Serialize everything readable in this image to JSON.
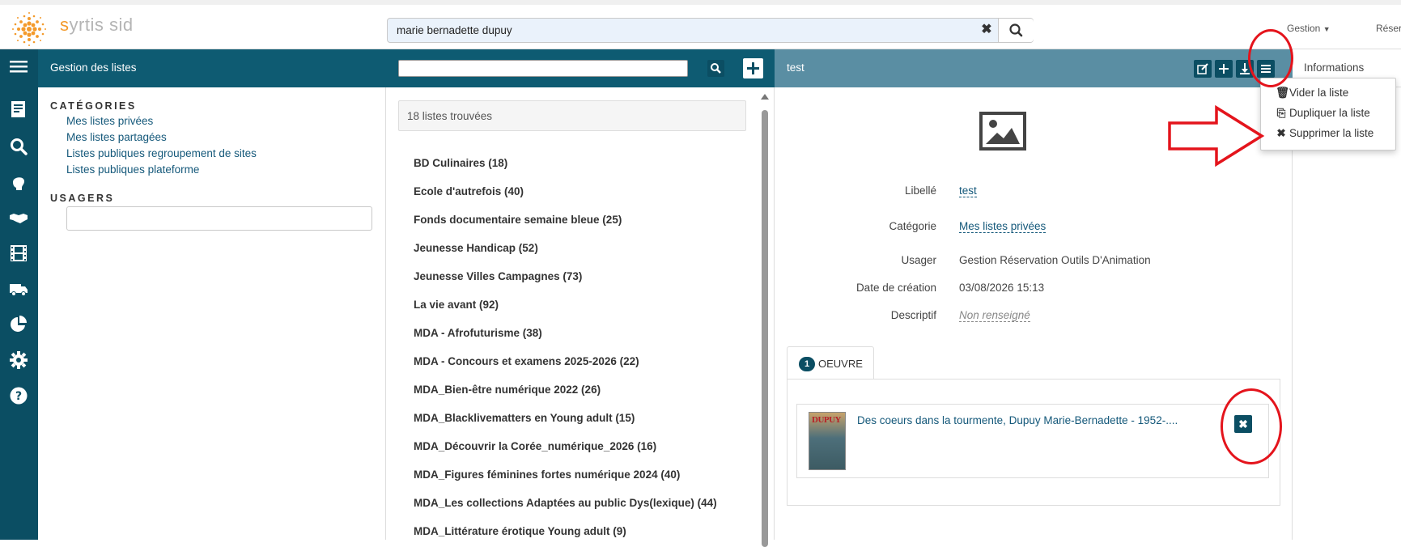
{
  "app": {
    "brand_prefix": "s",
    "brand_rest": "yrtis sid"
  },
  "search": {
    "value": "marie bernadette dupuy",
    "clear_icon": "times-icon",
    "search_icon": "search-icon"
  },
  "topmenu": {
    "gestion": "Gestion",
    "reser": "Réser"
  },
  "rail_icons": [
    "menu-icon",
    "catalog-icon",
    "search-icon",
    "user-head-icon",
    "handshake-icon",
    "film-icon",
    "truck-icon",
    "pie-chart-icon",
    "gear-icon",
    "help-icon"
  ],
  "left_panel": {
    "header": "Gestion des listes",
    "categories_title": "CATÉGORIES",
    "categories": [
      "Mes listes privées",
      "Mes listes partagées",
      "Listes publiques regroupement de sites",
      "Listes publiques plateforme"
    ],
    "usagers_title": "USAGERS",
    "usagers_value": ""
  },
  "mid_panel": {
    "count": "18 listes trouvées",
    "search_value": "",
    "lists": [
      "BD Culinaires (18)",
      "Ecole d'autrefois (40)",
      "Fonds documentaire semaine bleue (25)",
      "Jeunesse Handicap (52)",
      "Jeunesse Villes Campagnes (73)",
      "La vie avant (92)",
      "MDA - Afrofuturisme (38)",
      "MDA - Concours et examens 2025-2026 (22)",
      "MDA_Bien-être numérique 2022 (26)",
      "MDA_Blacklivematters en Young adult (15)",
      "MDA_Découvrir la Corée_numérique_2026 (16)",
      "MDA_Figures féminines fortes numérique 2024 (40)",
      "MDA_Les collections Adaptées au public Dys(lexique) (44)",
      "MDA_Littérature érotique Young adult (9)"
    ]
  },
  "detail": {
    "header": "test",
    "info_tab": "Informations",
    "fields": {
      "libelle_label": "Libellé",
      "libelle_value": "test",
      "categorie_label": "Catégorie",
      "categorie_value": "Mes listes privées",
      "usager_label": "Usager",
      "usager_value": "Gestion Réservation Outils D'Animation",
      "date_label": "Date de création",
      "date_value": "03/08/2026 15:13",
      "descriptif_label": "Descriptif",
      "descriptif_value": "Non renseigné"
    },
    "tab": {
      "badge": "1",
      "label": "OEUVRE"
    },
    "oeuvre": {
      "cover_text": "DUPUY",
      "title": "Des coeurs dans la tourmente, Dupuy Marie-Bernadette - 1952-....",
      "delete_icon": "times-icon"
    }
  },
  "dropdown": {
    "items": [
      {
        "icon": "trash-icon",
        "label": "Vider la liste"
      },
      {
        "icon": "copy-icon",
        "label": "Dupliquer la liste"
      },
      {
        "icon": "times-icon",
        "label": "Supprimer la liste"
      }
    ]
  },
  "colors": {
    "rail": "#0b4e63",
    "header": "#0e5b72",
    "detail_header": "#5a8ea3",
    "link": "#14587a",
    "annotation": "#e4141c",
    "brand_orange": "#f39a2c"
  }
}
